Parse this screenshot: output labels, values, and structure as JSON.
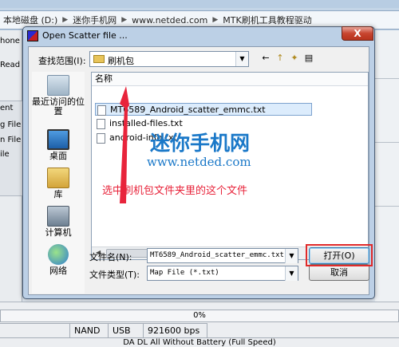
{
  "background": {
    "address": [
      "本地磁盘 (D:)",
      "迷你手机网",
      "www.netded.com",
      "MTK刷机工具教程驱动"
    ],
    "left_fragments": [
      "hone F",
      "Read b",
      "ent",
      "g File",
      "n File",
      "ile"
    ],
    "progress_text": "0%",
    "status": [
      "NAND",
      "USB",
      "921600 bps"
    ],
    "status_line2": "DA DL All Without Battery (Full Speed)"
  },
  "dialog": {
    "title": "Open Scatter file ...",
    "close_label": "X",
    "look_in_label": "查找范围(I):",
    "look_in_value": "刷机包",
    "toolbar": {
      "back": "←",
      "up": "↑",
      "new_folder": "✦",
      "views": "▤"
    },
    "places": [
      {
        "label": "最近访问的位置",
        "icon": "recent-places-icon"
      },
      {
        "label": "桌面",
        "icon": "desktop-icon"
      },
      {
        "label": "库",
        "icon": "libraries-icon"
      },
      {
        "label": "计算机",
        "icon": "computer-icon"
      },
      {
        "label": "网络",
        "icon": "network-icon"
      }
    ],
    "column_name": "名称",
    "files": [
      "MT6589_Android_scatter_emmc.txt",
      "installed-files.txt",
      "android-info.txt"
    ],
    "selected_index": 0,
    "filename_label": "文件名(N):",
    "filename_value": "MT6589_Android_scatter_emmc.txt",
    "filetype_label": "文件类型(T):",
    "filetype_value": "Map File (*.txt)",
    "open_button": "打开(O)",
    "cancel_button": "取消"
  },
  "overlay": {
    "watermark": "迷你手机网",
    "watermark_url": "www.netded.com",
    "annotation": "选中刷机包文件夹里的这个文件"
  },
  "colors": {
    "annotation_red": "#e8243b",
    "watermark_blue": "#1a78c8",
    "selection": "#dcecfc"
  }
}
